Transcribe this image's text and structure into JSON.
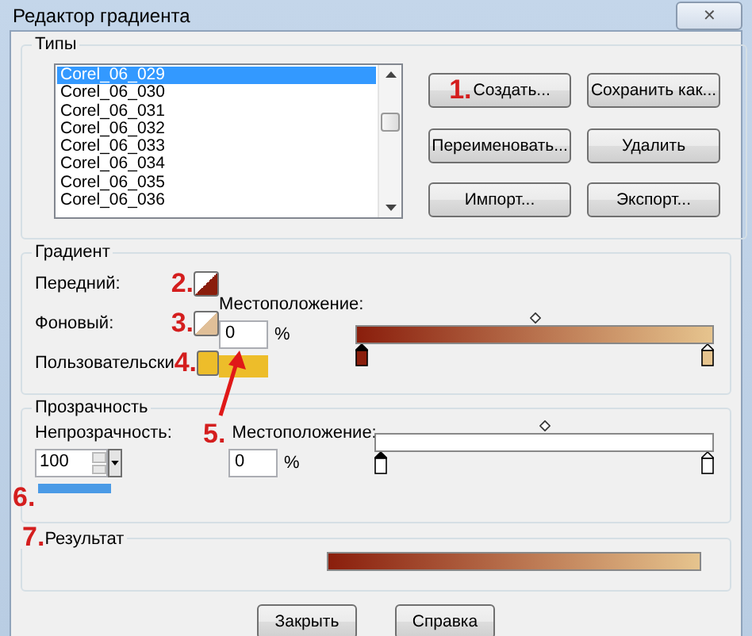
{
  "window": {
    "title": "Редактор градиента",
    "close": "✕"
  },
  "types": {
    "label": "Типы",
    "items": [
      {
        "label": "Corel_06_029",
        "selected": true
      },
      {
        "label": "Corel_06_030",
        "selected": false
      },
      {
        "label": "Corel_06_031",
        "selected": false
      },
      {
        "label": "Corel_06_032",
        "selected": false
      },
      {
        "label": "Corel_06_033",
        "selected": false
      },
      {
        "label": "Corel_06_034",
        "selected": false
      },
      {
        "label": "Corel_06_035",
        "selected": false
      },
      {
        "label": "Corel_06_036",
        "selected": false
      }
    ],
    "buttons": [
      {
        "label": "Создать...",
        "step": "1."
      },
      {
        "label": "Сохранить как..."
      },
      {
        "label": "Переименовать..."
      },
      {
        "label": "Удалить"
      },
      {
        "label": "Импорт..."
      },
      {
        "label": "Экспорт..."
      }
    ]
  },
  "gradient": {
    "label": "Градиент",
    "colors": [
      {
        "label": "Передний:",
        "step": "2.",
        "kind": "split",
        "color": "#8a1e0c"
      },
      {
        "label": "Фоновый:",
        "step": "3.",
        "kind": "split",
        "color": "#e0bf98"
      },
      {
        "label": "Пользовательски",
        "step": "4.",
        "kind": "solid",
        "color": "#edbd2a"
      }
    ],
    "location_label": "Местоположение:",
    "location": "0",
    "unit": "%",
    "stops": [
      {
        "color": "#8a1e0c",
        "selected": true
      },
      {
        "color": "#e6c48e",
        "selected": false
      }
    ]
  },
  "transparency": {
    "label": "Прозрачность",
    "opacity_label": "Непрозрачность:",
    "opacity": "100",
    "opacity_step": "6.",
    "location_step": "5.",
    "location_label": "Местоположение:",
    "location": "0",
    "unit": "%"
  },
  "result": {
    "label": "Результат",
    "step": "7."
  },
  "buttons": [
    "Закрыть",
    "Справка"
  ]
}
